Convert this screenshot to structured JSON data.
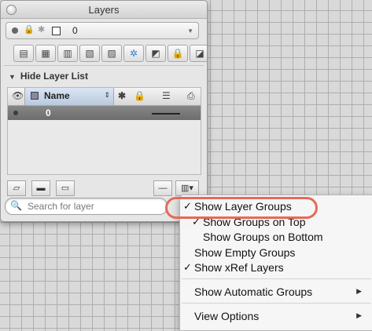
{
  "window": {
    "title": "Layers"
  },
  "current_layer": {
    "name": "0",
    "state_glyphs": [
      "🔒",
      "✱"
    ]
  },
  "toolbar": {
    "tools": [
      "new-layer-icon",
      "layer-properties-icon",
      "set-current-icon",
      "layer-state-icon",
      "match-layer-icon",
      "freeze-icon",
      "isolate-icon",
      "lock-icon",
      "unisolate-icon"
    ]
  },
  "layer_list": {
    "toggle_label": "Hide Layer List",
    "columns": {
      "name": "Name"
    },
    "rows": [
      {
        "name": "0"
      }
    ]
  },
  "search": {
    "placeholder": "Search for layer"
  },
  "context_menu": {
    "items": [
      {
        "label": "Show Layer Groups",
        "checked": true
      },
      {
        "label": "Show Groups on Top",
        "checked": true
      },
      {
        "label": "Show Groups on Bottom",
        "checked": false
      },
      {
        "label": "Show Empty Groups",
        "checked": false
      },
      {
        "label": "Show xRef Layers",
        "checked": true
      },
      {
        "label": "Show Automatic Groups",
        "submenu": true
      },
      {
        "label": "View Options",
        "submenu": true
      }
    ],
    "check_glyph": "✓",
    "submenu_glyph": "▶"
  },
  "colors": {
    "highlight_ring": "#e46a58",
    "selected_row": "#787878",
    "grid_line": "#aeaeae"
  }
}
